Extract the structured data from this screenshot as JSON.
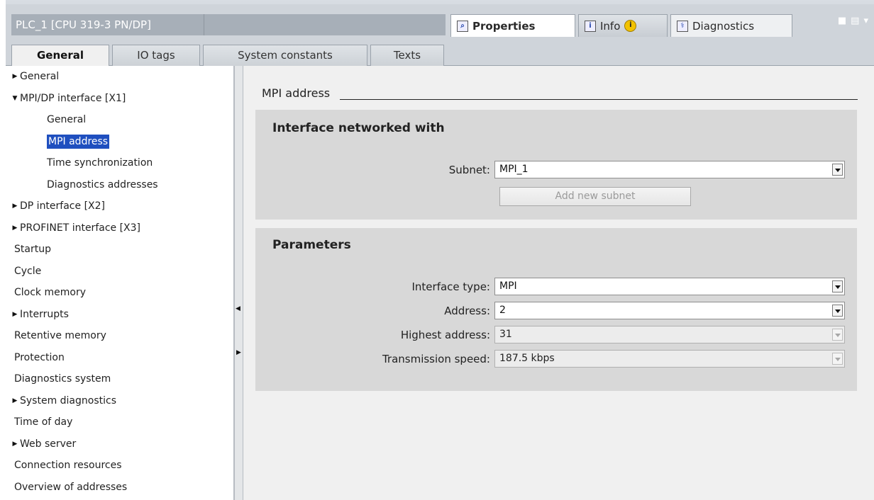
{
  "window": {
    "title": "PLC_1 [CPU 319-3 PN/DP]",
    "properties_tab": "Properties",
    "info_tab": "Info",
    "diagnostics_tab": "Diagnostics",
    "info_badge": "i"
  },
  "subtabs": [
    "General",
    "IO tags",
    "System constants",
    "Texts"
  ],
  "tree": {
    "items": [
      {
        "label": "General",
        "expander": "collapsed",
        "level": 0
      },
      {
        "label": "MPI/DP interface [X1]",
        "expander": "expanded",
        "level": 0
      },
      {
        "label": "General",
        "level": 1
      },
      {
        "label": "MPI address",
        "level": 1,
        "selected": true
      },
      {
        "label": "Time synchronization",
        "level": 1
      },
      {
        "label": "Diagnostics addresses",
        "level": 1
      },
      {
        "label": "DP interface [X2]",
        "expander": "collapsed",
        "level": 0
      },
      {
        "label": "PROFINET interface [X3]",
        "expander": "collapsed",
        "level": 0
      },
      {
        "label": "Startup",
        "level": 0
      },
      {
        "label": "Cycle",
        "level": 0
      },
      {
        "label": "Clock memory",
        "level": 0
      },
      {
        "label": "Interrupts",
        "expander": "collapsed",
        "level": 0
      },
      {
        "label": "Retentive memory",
        "level": 0
      },
      {
        "label": "Protection",
        "level": 0
      },
      {
        "label": "Diagnostics system",
        "level": 0
      },
      {
        "label": "System diagnostics",
        "expander": "collapsed",
        "level": 0
      },
      {
        "label": "Time of day",
        "level": 0
      },
      {
        "label": "Web server",
        "expander": "collapsed",
        "level": 0
      },
      {
        "label": "Connection resources",
        "level": 0
      },
      {
        "label": "Overview of addresses",
        "level": 0
      }
    ]
  },
  "main": {
    "section_title": "MPI address",
    "networked": {
      "title": "Interface networked with",
      "subnet_label": "Subnet:",
      "subnet_value": "MPI_1",
      "add_subnet_button": "Add new subnet"
    },
    "parameters": {
      "title": "Parameters",
      "interface_type_label": "Interface type:",
      "interface_type_value": "MPI",
      "address_label": "Address:",
      "address_value": "2",
      "highest_address_label": "Highest address:",
      "highest_address_value": "31",
      "transmission_speed_label": "Transmission speed:",
      "transmission_speed_value": "187.5 kbps"
    }
  },
  "colors": {
    "selection": "#1f4fbf",
    "panel": "#d8d8d8",
    "chrome": "#cfd4da"
  }
}
